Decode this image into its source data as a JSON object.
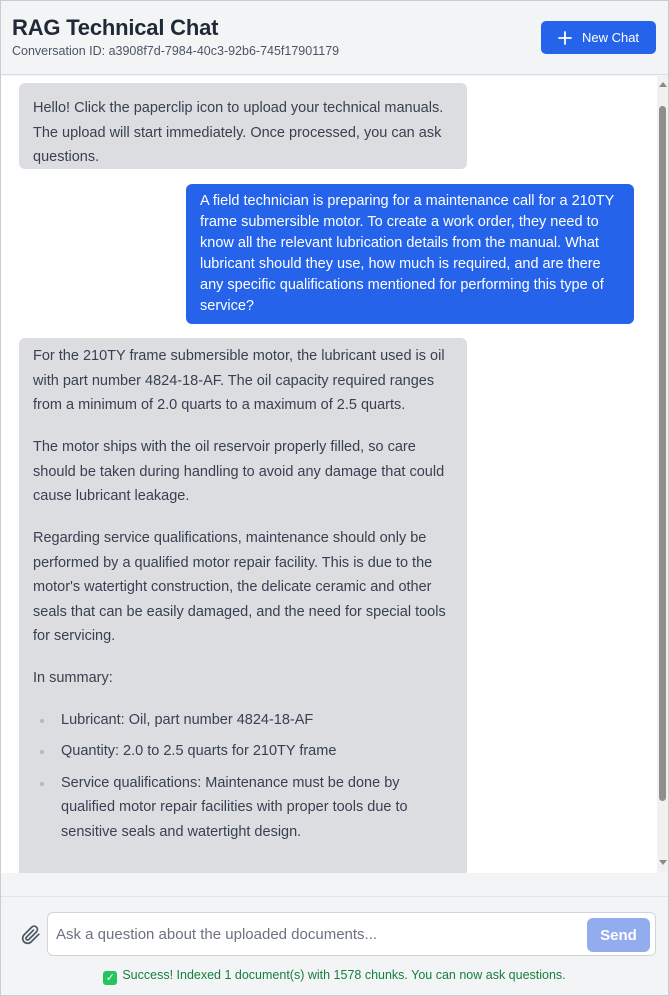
{
  "header": {
    "title": "RAG Technical Chat",
    "conversation_id": "Conversation ID: a3908f7d-7984-40c3-92b6-745f17901179",
    "new_chat_label": "New Chat"
  },
  "messages": [
    {
      "role": "assistant",
      "paragraphs": [
        "Hello! Click the paperclip icon to upload your technical manuals. The upload will start immediately. Once processed, you can ask questions."
      ]
    },
    {
      "role": "user",
      "paragraphs": [
        "A field technician is preparing for a maintenance call for a 210TY frame submersible motor. To create a work order, they need to know all the relevant lubrication details from the manual. What lubricant should they use, how much is required, and are there any specific qualifications mentioned for performing this type of service?"
      ]
    },
    {
      "role": "assistant",
      "paragraphs": [
        "For the 210TY frame submersible motor, the lubricant used is oil with part number 4824-18-AF. The oil capacity required ranges from a minimum of 2.0 quarts to a maximum of 2.5 quarts.",
        "The motor ships with the oil reservoir properly filled, so care should be taken during handling to avoid any damage that could cause lubricant leakage.",
        "Regarding service qualifications, maintenance should only be performed by a qualified motor repair facility. This is due to the motor's watertight construction, the delicate ceramic and other seals that can be easily damaged, and the need for special tools for servicing.",
        "In summary:"
      ],
      "bullets": [
        "Lubricant: Oil, part number 4824-18-AF",
        "Quantity: 2.0 to 2.5 quarts for 210TY frame",
        "Service qualifications: Maintenance must be done by qualified motor repair facilities with proper tools due to sensitive seals and watertight design."
      ]
    }
  ],
  "composer": {
    "placeholder": "Ask a question about the uploaded documents...",
    "value": "",
    "send_label": "Send"
  },
  "status": {
    "icon": "check-mark-icon",
    "text": "Success! Indexed 1 document(s) with 1578 chunks. You can now ask questions."
  },
  "colors": {
    "accent": "#2563eb",
    "send_disabled": "#93acee",
    "assistant_bubble": "#dcdde1",
    "success_text": "#15803d"
  }
}
